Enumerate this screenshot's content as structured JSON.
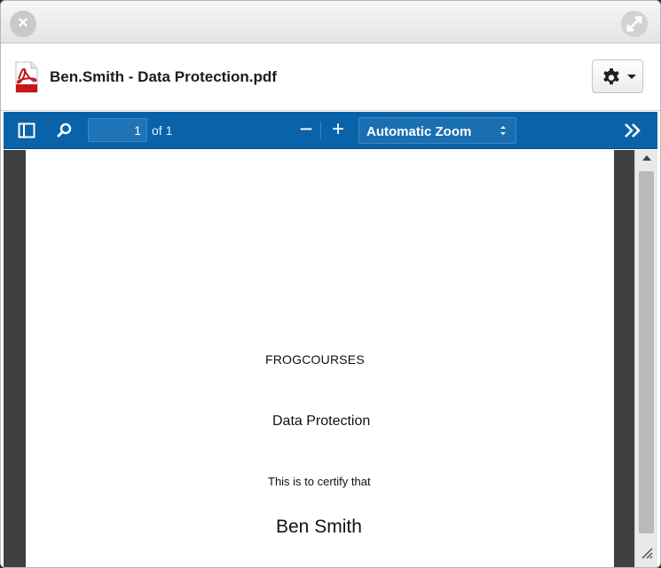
{
  "window": {
    "close_icon": "close-icon",
    "expand_icon": "expand-icon"
  },
  "file": {
    "icon": "pdf-file-icon",
    "title": "Ben.Smith - Data Protection.pdf",
    "settings_icon": "gear-icon"
  },
  "toolbar": {
    "sidebar_toggle_icon": "sidebar-toggle-icon",
    "search_icon": "search-icon",
    "page_number": "1",
    "page_count": "of 1",
    "zoom_out_label": "−",
    "zoom_in_label": "+",
    "zoom_value": "Automatic Zoom",
    "more_icon": "double-chevron-right-icon",
    "accent_color": "#0a63a9"
  },
  "document": {
    "brand": "FROGCOURSES",
    "course": "Data Protection",
    "certify_text": "This is to certify that",
    "recipient": "Ben Smith"
  }
}
